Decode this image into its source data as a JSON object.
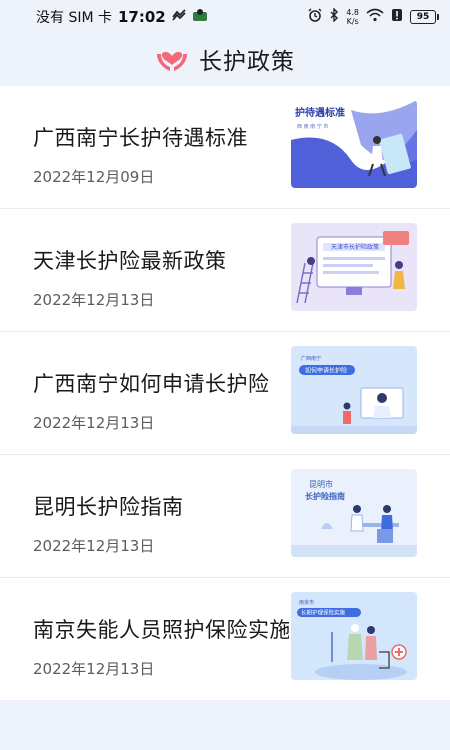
{
  "status_bar": {
    "carrier": "没有 SIM 卡",
    "time": "17:02",
    "net_speed_value": "4.8",
    "net_speed_unit": "K/s",
    "battery": "95"
  },
  "header": {
    "title": "长护政策",
    "logo_icon": "heart-hands-icon",
    "accent_color": "#f06a7a"
  },
  "articles": [
    {
      "title": "广西南宁长护待遇标准",
      "date": "2022年12月09日",
      "thumb_heading": "护待遇标准",
      "thumb_sub": "西 南 南 宁 市"
    },
    {
      "title": "天津长护险最新政策",
      "date": "2022年12月13日",
      "thumb_heading": "天津市长护险政策"
    },
    {
      "title": "广西南宁如何申请长护险",
      "date": "2022年12月13日",
      "thumb_sub": "广西南宁",
      "thumb_heading": "如何申请长护险"
    },
    {
      "title": "昆明长护险指南",
      "date": "2022年12月13日",
      "thumb_sub": "昆明市",
      "thumb_heading": "长护险指南"
    },
    {
      "title": "南京失能人员照护保险实施",
      "date": "2022年12月13日",
      "thumb_sub": "南京市",
      "thumb_heading": "长期护理保险实施"
    }
  ]
}
